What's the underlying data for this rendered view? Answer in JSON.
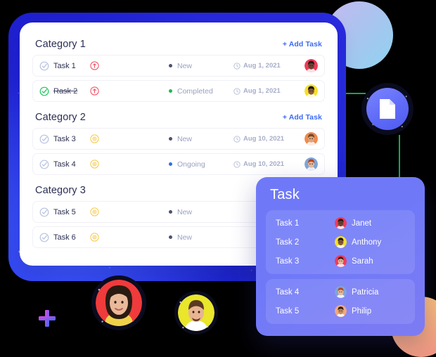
{
  "board": {
    "add_task_label": "+ Add Task",
    "categories": [
      {
        "title": "Category 1",
        "tasks": [
          {
            "name": "Task 1",
            "completed": false,
            "priority": "priority-high-icon",
            "priority_color": "#ef4a5e",
            "status": "New",
            "status_color": "#4b5270",
            "date": "Aug 1, 2021",
            "avatar_bg": "#ef3b5b",
            "avatar_skin": "#6b4232",
            "avatar_hair": "#241a14"
          },
          {
            "name": "Rask 2",
            "completed": true,
            "priority": "priority-high-icon",
            "priority_color": "#ef4a5e",
            "status": "Completed",
            "status_color": "#1db954",
            "date": "Aug 1, 2021",
            "avatar_bg": "#f4e02a",
            "avatar_skin": "#8a5a3b",
            "avatar_hair": "#1b1410"
          }
        ]
      },
      {
        "title": "Category 2",
        "tasks": [
          {
            "name": "Task 3",
            "completed": false,
            "priority": "priority-medium-icon",
            "priority_color": "#f7c948",
            "status": "New",
            "status_color": "#4b5270",
            "date": "Aug 10, 2021",
            "avatar_bg": "#f08a4b",
            "avatar_skin": "#e0a57c",
            "avatar_hair": "#6b4a2e"
          },
          {
            "name": "Task 4",
            "completed": false,
            "priority": "priority-medium-icon",
            "priority_color": "#f7c948",
            "status": "Ongoing",
            "status_color": "#2f6fe0",
            "date": "Aug 10, 2021",
            "avatar_bg": "#7fa5d8",
            "avatar_skin": "#e8b79a",
            "avatar_hair": "#b5491f"
          }
        ]
      },
      {
        "title": "Category 3",
        "tasks": [
          {
            "name": "Task 5",
            "completed": false,
            "priority": "priority-medium-icon",
            "priority_color": "#f7c948",
            "status": "New",
            "status_color": "#4b5270",
            "date": "",
            "avatar_bg": "",
            "avatar_skin": "",
            "avatar_hair": ""
          },
          {
            "name": "Task 6",
            "completed": false,
            "priority": "priority-medium-icon",
            "priority_color": "#f7c948",
            "status": "New",
            "status_color": "#4b5270",
            "date": "",
            "avatar_bg": "",
            "avatar_skin": "",
            "avatar_hair": ""
          }
        ]
      }
    ]
  },
  "panel": {
    "title": "Task",
    "groups": [
      {
        "rows": [
          {
            "task": "Task 1",
            "person": "Janet",
            "avatar_bg": "#ef3b5b",
            "avatar_skin": "#6b4232",
            "avatar_hair": "#241a14"
          },
          {
            "task": "Task 2",
            "person": "Anthony",
            "avatar_bg": "#f4e02a",
            "avatar_skin": "#8a5a3b",
            "avatar_hair": "#1b1410"
          },
          {
            "task": "Task 3",
            "person": "Sarah",
            "avatar_bg": "#ef3b5b",
            "avatar_skin": "#e8b79a",
            "avatar_hair": "#3a2118"
          }
        ]
      },
      {
        "rows": [
          {
            "task": "Task 4",
            "person": "Patricia",
            "avatar_bg": "#7fa5d8",
            "avatar_skin": "#e8b79a",
            "avatar_hair": "#b5491f"
          },
          {
            "task": "Task 5",
            "person": "Philip",
            "avatar_bg": "#f2a97e",
            "avatar_skin": "#c98a5f",
            "avatar_hair": "#2a1d14"
          }
        ]
      }
    ]
  },
  "doc_badge": {
    "icon": "document-icon",
    "circle_color": "#5f6bf7"
  },
  "floating_avatars": [
    {
      "name": "floating-avatar-1",
      "bg": "#ef3b3b",
      "skin": "#e9b99a",
      "hair": "#2a1b12"
    },
    {
      "name": "floating-avatar-2",
      "bg": "#e9e62b",
      "skin": "#e8b492",
      "hair": "#5a3a22"
    }
  ],
  "add_button": {
    "icon": "plus-icon",
    "color_start": "#e04ae0",
    "color_end": "#3d6bf5"
  },
  "accents": {
    "frame_blue": "#2230e0",
    "chevron_orange": "#f0a32a",
    "panel_purple": "#6f79f8"
  }
}
